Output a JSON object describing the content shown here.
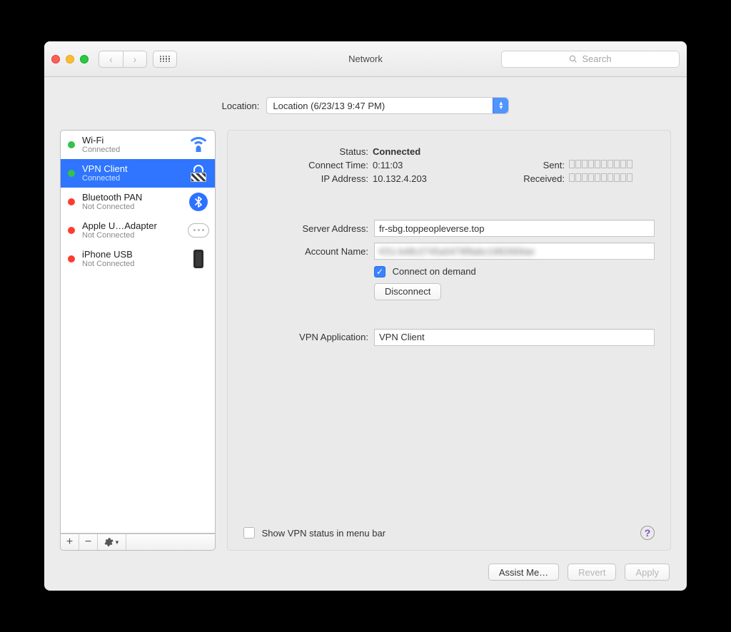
{
  "window": {
    "title": "Network"
  },
  "toolbar": {
    "search_placeholder": "Search"
  },
  "location": {
    "label": "Location:",
    "value": "Location (6/23/13 9:47 PM)"
  },
  "sidebar": {
    "items": [
      {
        "name": "Wi-Fi",
        "status": "Connected",
        "dot": "green"
      },
      {
        "name": "VPN Client",
        "status": "Connected",
        "dot": "green"
      },
      {
        "name": "Bluetooth PAN",
        "status": "Not Connected",
        "dot": "red"
      },
      {
        "name": "Apple U…Adapter",
        "status": "Not Connected",
        "dot": "red"
      },
      {
        "name": "iPhone USB",
        "status": "Not Connected",
        "dot": "red"
      }
    ]
  },
  "detail": {
    "status_label": "Status:",
    "status_value": "Connected",
    "connect_time_label": "Connect Time:",
    "connect_time_value": "0:11:03",
    "ip_label": "IP Address:",
    "ip_value": "10.132.4.203",
    "sent_label": "Sent:",
    "received_label": "Received:",
    "server_label": "Server Address:",
    "server_value": "fr-sbg.toppeopleverse.top",
    "account_label": "Account Name:",
    "account_value": "K51-b48c2745a0479f9abc1982669ae",
    "connect_on_demand": "Connect on demand",
    "disconnect": "Disconnect",
    "vpn_app_label": "VPN Application:",
    "vpn_app_value": "VPN Client",
    "menubar": "Show VPN status in menu bar"
  },
  "footer": {
    "assist": "Assist Me…",
    "revert": "Revert",
    "apply": "Apply"
  }
}
